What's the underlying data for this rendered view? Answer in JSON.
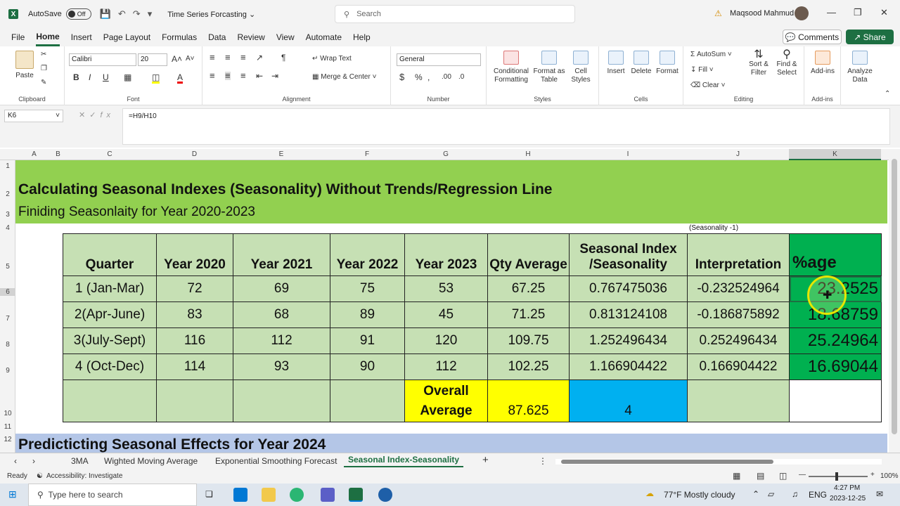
{
  "titlebar": {
    "autosave_label": "AutoSave",
    "autosave_state": "Off",
    "document_title": "Time Series Forcasting",
    "search_placeholder": "Search",
    "user_name": "Maqsood Mahmud"
  },
  "menu": {
    "items": [
      "File",
      "Home",
      "Insert",
      "Page Layout",
      "Formulas",
      "Data",
      "Review",
      "View",
      "Automate",
      "Help"
    ],
    "active": "Home",
    "comments_label": "Comments",
    "share_label": "Share"
  },
  "ribbon": {
    "clipboard": {
      "paste": "Paste",
      "label": "Clipboard"
    },
    "font": {
      "name": "Calibri",
      "size": "20",
      "label": "Font"
    },
    "alignment": {
      "wrap_text": "Wrap Text",
      "merge_center": "Merge & Center",
      "label": "Alignment"
    },
    "number": {
      "format": "General",
      "label": "Number"
    },
    "styles": {
      "conditional": "Conditional Formatting",
      "format_table": "Format as Table",
      "cell_styles": "Cell Styles",
      "label": "Styles"
    },
    "cells": {
      "insert": "Insert",
      "delete": "Delete",
      "format": "Format",
      "label": "Cells"
    },
    "editing": {
      "autosum": "AutoSum",
      "fill": "Fill",
      "clear": "Clear",
      "sort_filter": "Sort & Filter",
      "find_select": "Find & Select",
      "label": "Editing"
    },
    "addins": {
      "addins": "Add-ins",
      "label": "Add-ins"
    },
    "analyze": {
      "label": "Analyze Data"
    }
  },
  "formula_bar": {
    "name_box": "K6",
    "formula": "=H9/H10"
  },
  "columns": [
    "A",
    "B",
    "C",
    "D",
    "E",
    "F",
    "G",
    "H",
    "I",
    "J",
    "K"
  ],
  "rows": [
    "1",
    "2",
    "3",
    "4",
    "5",
    "6",
    "7",
    "8",
    "9",
    "10",
    "11",
    "12"
  ],
  "sheet": {
    "title": "Calculating Seasonal Indexes (Seasonality) Without Trends/Regression Line",
    "subtitle": "Finiding Seasonlaity for Year 2020-2023",
    "note": "(Seasonality -1)",
    "headers": [
      "Quarter",
      "Year 2020",
      "Year 2021",
      "Year 2022",
      "Year 2023",
      "Qty Average",
      "Seasonal Index /Seasonality",
      "Interpretation",
      "%age"
    ],
    "rows": [
      [
        "1 (Jan-Mar)",
        "72",
        "69",
        "75",
        "53",
        "67.25",
        "0.767475036",
        "-0.232524964",
        "23.2525"
      ],
      [
        "2(Apr-June)",
        "83",
        "68",
        "89",
        "45",
        "71.25",
        "0.813124108",
        "-0.186875892",
        "18.68759"
      ],
      [
        "3(July-Sept)",
        "116",
        "112",
        "91",
        "120",
        "109.75",
        "1.252496434",
        "0.252496434",
        "25.24964"
      ],
      [
        "4 (Oct-Dec)",
        "114",
        "93",
        "90",
        "112",
        "102.25",
        "1.166904422",
        "0.166904422",
        "16.69044"
      ]
    ],
    "overall_label": "Overall Average",
    "overall_value": "87.625",
    "count_value": "4",
    "section2_title": "Predicticting Seasonal Effects for Year 2024"
  },
  "tabs": {
    "items": [
      "3MA",
      "Wighted Moving Average",
      "Exponential Smoothing Forecast",
      "Seasonal Index-Seasonality"
    ],
    "active": "Seasonal Index-Seasonality"
  },
  "status": {
    "ready": "Ready",
    "accessibility": "Accessibility: Investigate",
    "zoom": "100%"
  },
  "taskbar": {
    "search_placeholder": "Type here to search",
    "weather": "77°F  Mostly cloudy",
    "language": "ENG",
    "time": "4:27 PM",
    "date": "2023-12-25"
  },
  "colors": {
    "excel_green": "#1d6f42",
    "header_green": "#92d050",
    "table_green": "#c6e0b4",
    "pct_green": "#00b050",
    "yellow": "#ffff00",
    "blue": "#00b0f0",
    "band_blue": "#b4c6e7"
  }
}
